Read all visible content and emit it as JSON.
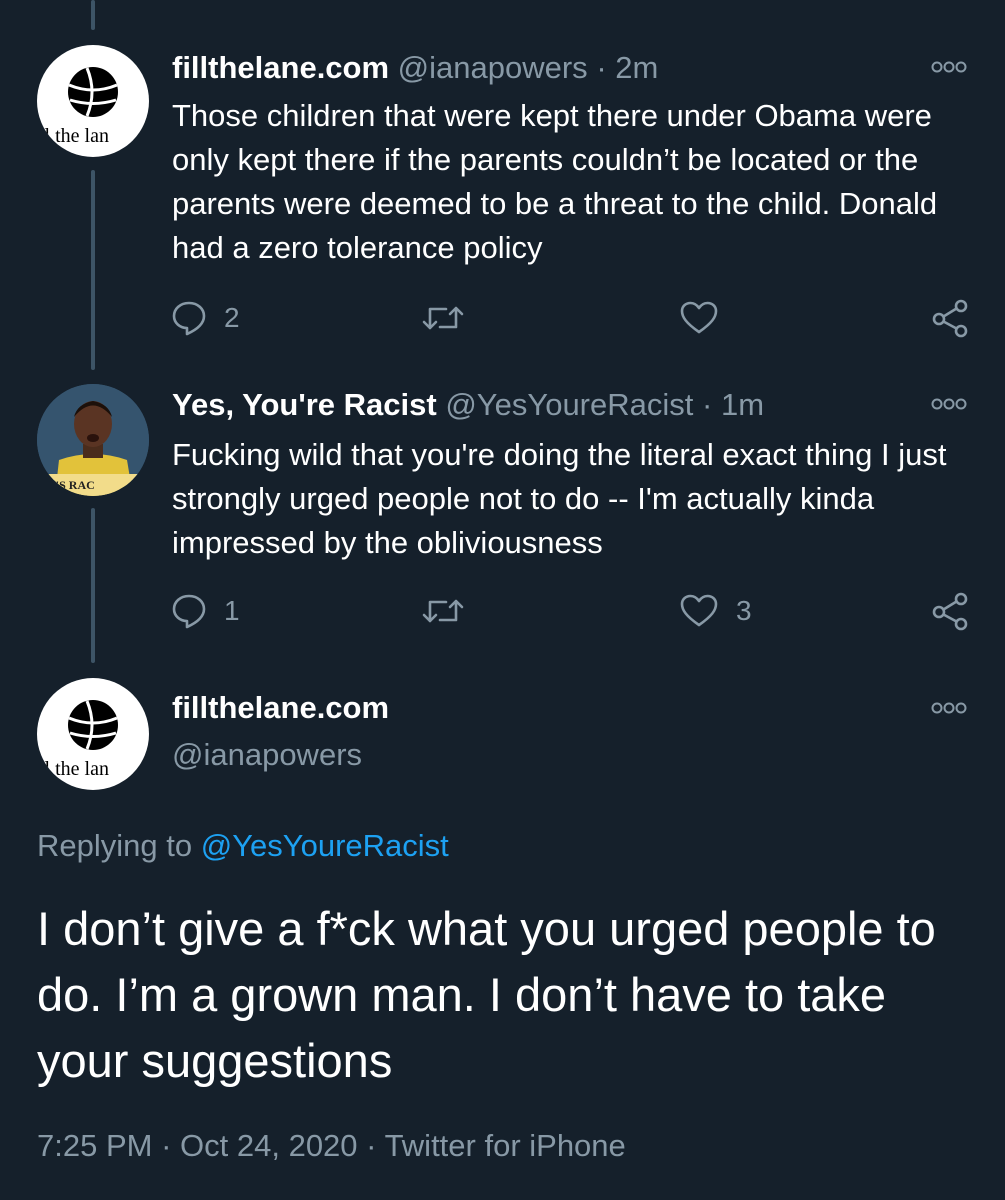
{
  "tweets": [
    {
      "name": "fillthelane.com",
      "handle": "@ianapowers",
      "dot": "·",
      "time": "2m",
      "text": "Those children that were kept there under Obama were only kept there if the parents couldn’t be located or the parents were deemed to be a threat to the child. Donald had a zero tolerance policy",
      "avatar_text": "ll the lan",
      "replies": "2",
      "retweets": "",
      "likes": ""
    },
    {
      "name": "Yes, You're Racist",
      "handle": "@YesYoureRacist",
      "dot": "·",
      "time": "1m",
      "text": "Fucking wild that you're doing the literal exact thing I just strongly urged people not to do -- I'm actually kinda impressed by the obliviousness",
      "avatar_text": "AT'S RAC",
      "replies": "1",
      "retweets": "",
      "likes": "3"
    }
  ],
  "focus": {
    "name": "fillthelane.com",
    "handle": "@ianapowers",
    "avatar_text": "ll the lan",
    "replying_prefix": "Replying to ",
    "replying_handle": "@YesYoureRacist",
    "text": "I don’t give a f*ck what you urged people to do. I’m a grown man. I don’t have to take your suggestions",
    "time": "7:25 PM",
    "date": "Oct 24, 2020",
    "source": "Twitter for iPhone",
    "sep": "·"
  },
  "icons": {
    "reply": "reply-bubble-icon",
    "retweet": "retweet-icon",
    "like": "heart-icon",
    "share": "share-icon",
    "more": "more-options-icon"
  },
  "colors": {
    "background": "#15202b",
    "muted": "#8899a6",
    "link": "#1da1f2",
    "thread_line": "#3d5466"
  }
}
